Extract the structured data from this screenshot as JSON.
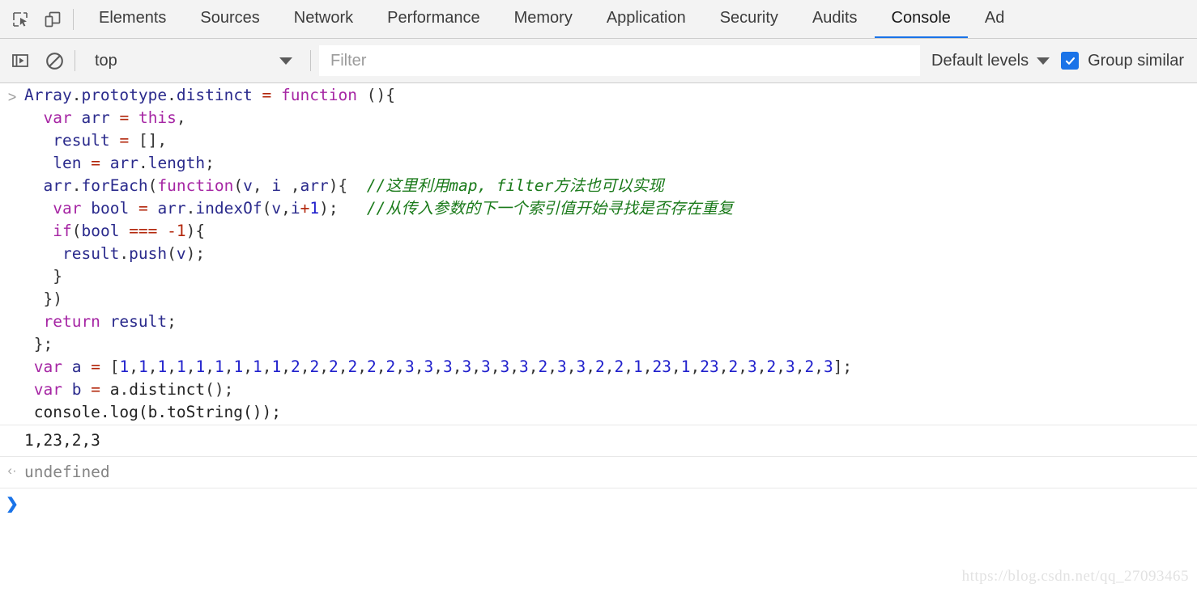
{
  "tabbar": {
    "icons": [
      {
        "name": "inspect-element-icon",
        "title": "Inspect element"
      },
      {
        "name": "device-toolbar-icon",
        "title": "Toggle device toolbar"
      }
    ],
    "tabs": [
      {
        "label": "Elements",
        "active": false
      },
      {
        "label": "Sources",
        "active": false
      },
      {
        "label": "Network",
        "active": false
      },
      {
        "label": "Performance",
        "active": false
      },
      {
        "label": "Memory",
        "active": false
      },
      {
        "label": "Application",
        "active": false
      },
      {
        "label": "Security",
        "active": false
      },
      {
        "label": "Audits",
        "active": false
      },
      {
        "label": "Console",
        "active": true
      },
      {
        "label": "Ad",
        "active": false
      }
    ],
    "active_tab": "Console",
    "accent_color": "#1a73e8"
  },
  "toolbar": {
    "sidebar_icon": "show-console-sidebar-icon",
    "clear_icon": "clear-console-icon",
    "context_value": "top",
    "filter_placeholder": "Filter",
    "filter_value": "",
    "levels_label": "Default levels",
    "group_similar_label": "Group similar",
    "group_similar_checked": true,
    "checkbox_color": "#1a73e8"
  },
  "console": {
    "input_prompt_glyph": ">",
    "result_prompt_glyph": "‹·",
    "new_prompt_glyph": "❯",
    "input_lines": [
      [
        {
          "t": "Array",
          "c": "id"
        },
        {
          "t": ".",
          "c": "punc"
        },
        {
          "t": "prototype",
          "c": "id"
        },
        {
          "t": ".",
          "c": "punc"
        },
        {
          "t": "distinct",
          "c": "id"
        },
        {
          "t": " ",
          "c": "plain"
        },
        {
          "t": "=",
          "c": "op"
        },
        {
          "t": " ",
          "c": "plain"
        },
        {
          "t": "function",
          "c": "kw"
        },
        {
          "t": " (){",
          "c": "punc"
        }
      ],
      [
        {
          "t": "  ",
          "c": "plain"
        },
        {
          "t": "var",
          "c": "kw"
        },
        {
          "t": " ",
          "c": "plain"
        },
        {
          "t": "arr",
          "c": "id"
        },
        {
          "t": " ",
          "c": "plain"
        },
        {
          "t": "=",
          "c": "op"
        },
        {
          "t": " ",
          "c": "plain"
        },
        {
          "t": "this",
          "c": "kw"
        },
        {
          "t": ",",
          "c": "punc"
        }
      ],
      [
        {
          "t": "   ",
          "c": "plain"
        },
        {
          "t": "result",
          "c": "id"
        },
        {
          "t": " ",
          "c": "plain"
        },
        {
          "t": "=",
          "c": "op"
        },
        {
          "t": " ",
          "c": "plain"
        },
        {
          "t": "[],",
          "c": "punc"
        }
      ],
      [
        {
          "t": "   ",
          "c": "plain"
        },
        {
          "t": "len",
          "c": "id"
        },
        {
          "t": " ",
          "c": "plain"
        },
        {
          "t": "=",
          "c": "op"
        },
        {
          "t": " ",
          "c": "plain"
        },
        {
          "t": "arr",
          "c": "id"
        },
        {
          "t": ".",
          "c": "punc"
        },
        {
          "t": "length",
          "c": "id"
        },
        {
          "t": ";",
          "c": "punc"
        }
      ],
      [
        {
          "t": "  ",
          "c": "plain"
        },
        {
          "t": "arr",
          "c": "id"
        },
        {
          "t": ".",
          "c": "punc"
        },
        {
          "t": "forEach",
          "c": "id"
        },
        {
          "t": "(",
          "c": "punc"
        },
        {
          "t": "function",
          "c": "kw"
        },
        {
          "t": "(",
          "c": "punc"
        },
        {
          "t": "v",
          "c": "id"
        },
        {
          "t": ", ",
          "c": "punc"
        },
        {
          "t": "i",
          "c": "id"
        },
        {
          "t": " ,",
          "c": "punc"
        },
        {
          "t": "arr",
          "c": "id"
        },
        {
          "t": "){  ",
          "c": "punc"
        },
        {
          "t": "//这里利用map, filter方法也可以实现",
          "c": "cmt"
        }
      ],
      [
        {
          "t": "   ",
          "c": "plain"
        },
        {
          "t": "var",
          "c": "kw"
        },
        {
          "t": " ",
          "c": "plain"
        },
        {
          "t": "bool",
          "c": "id"
        },
        {
          "t": " ",
          "c": "plain"
        },
        {
          "t": "=",
          "c": "op"
        },
        {
          "t": " ",
          "c": "plain"
        },
        {
          "t": "arr",
          "c": "id"
        },
        {
          "t": ".",
          "c": "punc"
        },
        {
          "t": "indexOf",
          "c": "id"
        },
        {
          "t": "(",
          "c": "punc"
        },
        {
          "t": "v",
          "c": "id"
        },
        {
          "t": ",",
          "c": "punc"
        },
        {
          "t": "i",
          "c": "id"
        },
        {
          "t": "+",
          "c": "op"
        },
        {
          "t": "1",
          "c": "num"
        },
        {
          "t": ");   ",
          "c": "punc"
        },
        {
          "t": "//从传入参数的下一个索引值开始寻找是否存在重复",
          "c": "cmt"
        }
      ],
      [
        {
          "t": "   ",
          "c": "plain"
        },
        {
          "t": "if",
          "c": "kw"
        },
        {
          "t": "(",
          "c": "punc"
        },
        {
          "t": "bool",
          "c": "id"
        },
        {
          "t": " ",
          "c": "plain"
        },
        {
          "t": "===",
          "c": "op"
        },
        {
          "t": " ",
          "c": "plain"
        },
        {
          "t": "-1",
          "c": "op"
        },
        {
          "t": "){",
          "c": "punc"
        }
      ],
      [
        {
          "t": "    ",
          "c": "plain"
        },
        {
          "t": "result",
          "c": "id"
        },
        {
          "t": ".",
          "c": "punc"
        },
        {
          "t": "push",
          "c": "id"
        },
        {
          "t": "(",
          "c": "punc"
        },
        {
          "t": "v",
          "c": "id"
        },
        {
          "t": ");",
          "c": "punc"
        }
      ],
      [
        {
          "t": "   }",
          "c": "punc"
        }
      ],
      [
        {
          "t": "  })",
          "c": "punc"
        }
      ],
      [
        {
          "t": "  ",
          "c": "plain"
        },
        {
          "t": "return",
          "c": "kw"
        },
        {
          "t": " ",
          "c": "plain"
        },
        {
          "t": "result",
          "c": "id"
        },
        {
          "t": ";",
          "c": "punc"
        }
      ],
      [
        {
          "t": " };",
          "c": "punc"
        }
      ],
      [
        {
          "t": " ",
          "c": "plain"
        },
        {
          "t": "var",
          "c": "kw"
        },
        {
          "t": " ",
          "c": "plain"
        },
        {
          "t": "a",
          "c": "id"
        },
        {
          "t": " ",
          "c": "plain"
        },
        {
          "t": "=",
          "c": "op"
        },
        {
          "t": " [",
          "c": "punc"
        },
        {
          "t": "1",
          "c": "num"
        },
        {
          "t": ",",
          "c": "punc"
        },
        {
          "t": "1",
          "c": "num"
        },
        {
          "t": ",",
          "c": "punc"
        },
        {
          "t": "1",
          "c": "num"
        },
        {
          "t": ",",
          "c": "punc"
        },
        {
          "t": "1",
          "c": "num"
        },
        {
          "t": ",",
          "c": "punc"
        },
        {
          "t": "1",
          "c": "num"
        },
        {
          "t": ",",
          "c": "punc"
        },
        {
          "t": "1",
          "c": "num"
        },
        {
          "t": ",",
          "c": "punc"
        },
        {
          "t": "1",
          "c": "num"
        },
        {
          "t": ",",
          "c": "punc"
        },
        {
          "t": "1",
          "c": "num"
        },
        {
          "t": ",",
          "c": "punc"
        },
        {
          "t": "1",
          "c": "num"
        },
        {
          "t": ",",
          "c": "punc"
        },
        {
          "t": "2",
          "c": "num"
        },
        {
          "t": ",",
          "c": "punc"
        },
        {
          "t": "2",
          "c": "num"
        },
        {
          "t": ",",
          "c": "punc"
        },
        {
          "t": "2",
          "c": "num"
        },
        {
          "t": ",",
          "c": "punc"
        },
        {
          "t": "2",
          "c": "num"
        },
        {
          "t": ",",
          "c": "punc"
        },
        {
          "t": "2",
          "c": "num"
        },
        {
          "t": ",",
          "c": "punc"
        },
        {
          "t": "2",
          "c": "num"
        },
        {
          "t": ",",
          "c": "punc"
        },
        {
          "t": "3",
          "c": "num"
        },
        {
          "t": ",",
          "c": "punc"
        },
        {
          "t": "3",
          "c": "num"
        },
        {
          "t": ",",
          "c": "punc"
        },
        {
          "t": "3",
          "c": "num"
        },
        {
          "t": ",",
          "c": "punc"
        },
        {
          "t": "3",
          "c": "num"
        },
        {
          "t": ",",
          "c": "punc"
        },
        {
          "t": "3",
          "c": "num"
        },
        {
          "t": ",",
          "c": "punc"
        },
        {
          "t": "3",
          "c": "num"
        },
        {
          "t": ",",
          "c": "punc"
        },
        {
          "t": "3",
          "c": "num"
        },
        {
          "t": ",",
          "c": "punc"
        },
        {
          "t": "2",
          "c": "num"
        },
        {
          "t": ",",
          "c": "punc"
        },
        {
          "t": "3",
          "c": "num"
        },
        {
          "t": ",",
          "c": "punc"
        },
        {
          "t": "3",
          "c": "num"
        },
        {
          "t": ",",
          "c": "punc"
        },
        {
          "t": "2",
          "c": "num"
        },
        {
          "t": ",",
          "c": "punc"
        },
        {
          "t": "2",
          "c": "num"
        },
        {
          "t": ",",
          "c": "punc"
        },
        {
          "t": "1",
          "c": "num"
        },
        {
          "t": ",",
          "c": "punc"
        },
        {
          "t": "23",
          "c": "num"
        },
        {
          "t": ",",
          "c": "punc"
        },
        {
          "t": "1",
          "c": "num"
        },
        {
          "t": ",",
          "c": "punc"
        },
        {
          "t": "23",
          "c": "num"
        },
        {
          "t": ",",
          "c": "punc"
        },
        {
          "t": "2",
          "c": "num"
        },
        {
          "t": ",",
          "c": "punc"
        },
        {
          "t": "3",
          "c": "num"
        },
        {
          "t": ",",
          "c": "punc"
        },
        {
          "t": "2",
          "c": "num"
        },
        {
          "t": ",",
          "c": "punc"
        },
        {
          "t": "3",
          "c": "num"
        },
        {
          "t": ",",
          "c": "punc"
        },
        {
          "t": "2",
          "c": "num"
        },
        {
          "t": ",",
          "c": "punc"
        },
        {
          "t": "3",
          "c": "num"
        },
        {
          "t": "];",
          "c": "punc"
        }
      ],
      [
        {
          "t": " ",
          "c": "plain"
        },
        {
          "t": "var",
          "c": "kw"
        },
        {
          "t": " ",
          "c": "plain"
        },
        {
          "t": "b",
          "c": "id"
        },
        {
          "t": " ",
          "c": "plain"
        },
        {
          "t": "=",
          "c": "op"
        },
        {
          "t": " ",
          "c": "plain"
        },
        {
          "t": "a",
          "c": "plain"
        },
        {
          "t": ".",
          "c": "punc"
        },
        {
          "t": "distinct",
          "c": "plain"
        },
        {
          "t": "();",
          "c": "punc"
        }
      ],
      [
        {
          "t": " console.log(b.toString());",
          "c": "plain"
        }
      ]
    ],
    "output_text": "1,23,2,3",
    "result_text": "undefined"
  },
  "watermark": "https://blog.csdn.net/qq_27093465"
}
